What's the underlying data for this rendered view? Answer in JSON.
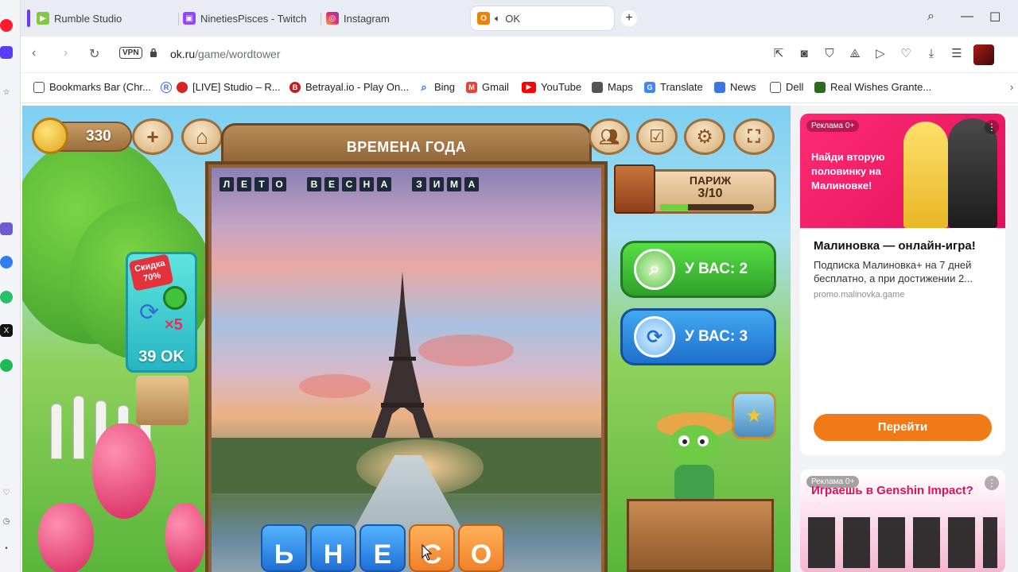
{
  "tabs": [
    {
      "title": "Rumble Studio",
      "icon": "rumble-icon",
      "color": "#85c742",
      "active": false
    },
    {
      "title": "NinetiesPisces - Twitch",
      "icon": "twitch-icon",
      "color": "#9146ff",
      "active": false
    },
    {
      "title": "Instagram",
      "icon": "instagram-icon",
      "color": "#e1306c",
      "active": false
    },
    {
      "title": "OK",
      "icon": "ok-icon",
      "color": "#ee8208",
      "active": true
    }
  ],
  "address": {
    "vpn_label": "VPN",
    "host": "ok.ru",
    "path": "/game/wordtower"
  },
  "bookmarks": [
    {
      "label": "Bookmarks Bar (Chr...",
      "icon": "folder-icon"
    },
    {
      "label": "[LIVE] Studio – R...",
      "icon": "rec-icon"
    },
    {
      "label": "Betrayal.io - Play On...",
      "icon": "betrayal-icon"
    },
    {
      "label": "Bing",
      "icon": "search-icon"
    },
    {
      "label": "Gmail",
      "icon": "gmail-icon"
    },
    {
      "label": "YouTube",
      "icon": "youtube-icon"
    },
    {
      "label": "Maps",
      "icon": "maps-icon"
    },
    {
      "label": "Translate",
      "icon": "translate-icon"
    },
    {
      "label": "News",
      "icon": "news-icon"
    },
    {
      "label": "Dell",
      "icon": "folder-icon"
    },
    {
      "label": "Real Wishes Grante...",
      "icon": "wishes-icon"
    }
  ],
  "game": {
    "coins": "330",
    "title": "ВРЕМЕНА ГОДА",
    "found_words": [
      "ЛЕТО",
      "ВЕСНА",
      "ЗИМА"
    ],
    "sale": {
      "tag": "Скидка 70%",
      "multiplier": "×5",
      "price": "39 OK"
    },
    "city": {
      "name": "ПАРИЖ",
      "progress": "3/10",
      "fraction": 0.3
    },
    "hint_button": "У ВАС: 2",
    "shuffle_button": "У ВАС: 3",
    "tiles": [
      {
        "letter": "Ь",
        "color": "blue"
      },
      {
        "letter": "Н",
        "color": "blue"
      },
      {
        "letter": "Е",
        "color": "blue"
      },
      {
        "letter": "С",
        "color": "orange"
      },
      {
        "letter": "О",
        "color": "orange"
      }
    ]
  },
  "ads": {
    "ad1": {
      "tag": "Реклама 0+",
      "image_text": "Найди вторую половинку на Малиновке!",
      "title": "Малиновка — онлайн-игра!",
      "description": "Подписка Малиновка+ на 7 дней бесплатно, а при достижении 2...",
      "domain": "promo.malinovka.game",
      "cta": "Перейти"
    },
    "ad2": {
      "tag": "Реклама 0+",
      "image_text": "Играешь в Genshin Impact?"
    }
  },
  "colors": {
    "accent_orange": "#f27a16",
    "ad_pink": "#e0105a",
    "hint_green": "#2ea02a",
    "shuffle_blue": "#1e6fce"
  }
}
